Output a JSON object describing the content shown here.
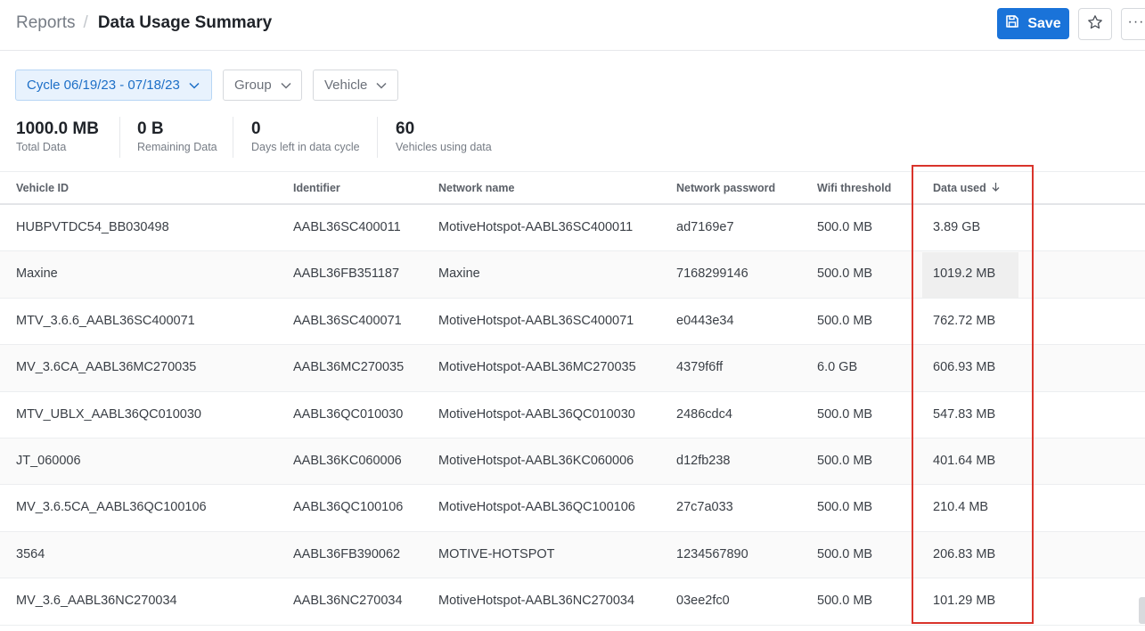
{
  "breadcrumb": {
    "parent": "Reports",
    "separator": "/",
    "current": "Data Usage Summary"
  },
  "toolbar": {
    "save_label": "Save",
    "more_label": "···"
  },
  "filters": {
    "cycle": "Cycle 06/19/23 - 07/18/23",
    "group": "Group",
    "vehicle": "Vehicle"
  },
  "stats": [
    {
      "value": "1000.0 MB",
      "label": "Total Data"
    },
    {
      "value": "0 B",
      "label": "Remaining Data"
    },
    {
      "value": "0",
      "label": "Days left in data cycle"
    },
    {
      "value": "60",
      "label": "Vehicles using data"
    }
  ],
  "table": {
    "headers": [
      "Vehicle ID",
      "Identifier",
      "Network name",
      "Network password",
      "Wifi threshold",
      "Data used"
    ],
    "sorted_column": "Data used",
    "sort_direction": "descending",
    "rows": [
      [
        "HUBPVTDC54_BB030498",
        "AABL36SC400011",
        "MotiveHotspot-AABL36SC400011",
        "ad7169e7",
        "500.0 MB",
        "3.89 GB"
      ],
      [
        "Maxine",
        "AABL36FB351187",
        "Maxine",
        "7168299146",
        "500.0 MB",
        "1019.2 MB"
      ],
      [
        "MTV_3.6.6_AABL36SC400071",
        "AABL36SC400071",
        "MotiveHotspot-AABL36SC400071",
        "e0443e34",
        "500.0 MB",
        "762.72 MB"
      ],
      [
        "MV_3.6CA_AABL36MC270035",
        "AABL36MC270035",
        "MotiveHotspot-AABL36MC270035",
        "4379f6ff",
        "6.0 GB",
        "606.93 MB"
      ],
      [
        "MTV_UBLX_AABL36QC010030",
        "AABL36QC010030",
        "MotiveHotspot-AABL36QC010030",
        "2486cdc4",
        "500.0 MB",
        "547.83 MB"
      ],
      [
        "JT_060006",
        "AABL36KC060006",
        "MotiveHotspot-AABL36KC060006",
        "d12fb238",
        "500.0 MB",
        "401.64 MB"
      ],
      [
        "MV_3.6.5CA_AABL36QC100106",
        "AABL36QC100106",
        "MotiveHotspot-AABL36QC100106",
        "27c7a033",
        "500.0 MB",
        "210.4 MB"
      ],
      [
        "3564",
        "AABL36FB390062",
        "MOTIVE-HOTSPOT",
        "1234567890",
        "500.0 MB",
        "206.83 MB"
      ],
      [
        "MV_3.6_AABL36NC270034",
        "AABL36NC270034",
        "MotiveHotspot-AABL36NC270034",
        "03ee2fc0",
        "500.0 MB",
        "101.29 MB"
      ]
    ]
  },
  "colors": {
    "accent": "#1a73d9",
    "highlight": "#d9342b",
    "filter_active_bg": "#e8f2fd"
  },
  "icons": {
    "save": "floppy-disk-icon",
    "star": "star-icon",
    "more": "ellipsis-icon",
    "chevron": "chevron-down-icon",
    "sort": "arrow-down-icon"
  }
}
